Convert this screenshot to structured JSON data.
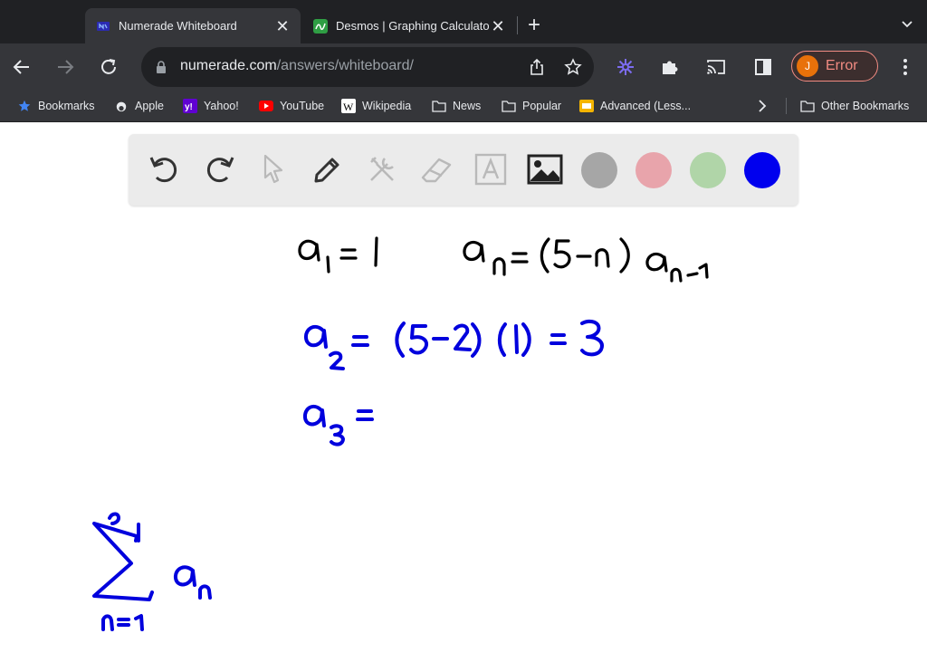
{
  "browser": {
    "tabs": [
      {
        "title": "Numerade Whiteboard",
        "active": true,
        "favicon": "numerade-icon"
      },
      {
        "title": "Desmos | Graphing Calculator",
        "active": false,
        "favicon": "desmos-icon"
      }
    ],
    "new_tab_label": "+",
    "url_host": "numerade.com",
    "url_path": "/answers/whiteboard/",
    "profile_initial": "J",
    "profile_label": "Error"
  },
  "bookmarks": [
    {
      "label": "Bookmarks",
      "icon": "star-icon"
    },
    {
      "label": "Apple",
      "icon": "apple-icon"
    },
    {
      "label": "Yahoo!",
      "icon": "yahoo-icon"
    },
    {
      "label": "YouTube",
      "icon": "youtube-icon"
    },
    {
      "label": "Wikipedia",
      "icon": "wikipedia-icon"
    },
    {
      "label": "News",
      "icon": "folder-icon"
    },
    {
      "label": "Popular",
      "icon": "folder-icon"
    },
    {
      "label": "Advanced (Less...",
      "icon": "bookmark-page-icon"
    },
    {
      "label": "Other Bookmarks",
      "icon": "folder-icon"
    }
  ],
  "whiteboard": {
    "tools": [
      "undo-icon",
      "redo-icon",
      "select-pointer-icon",
      "pen-icon",
      "tools-icon",
      "eraser-icon",
      "text-icon",
      "image-icon"
    ],
    "colors": [
      "#a6a6a6",
      "#e8a4ab",
      "#b0d5a8",
      "#0000ee"
    ],
    "active_color": "#0000ee",
    "ink_colors": {
      "black": "#000000",
      "blue": "#0000dd"
    }
  }
}
